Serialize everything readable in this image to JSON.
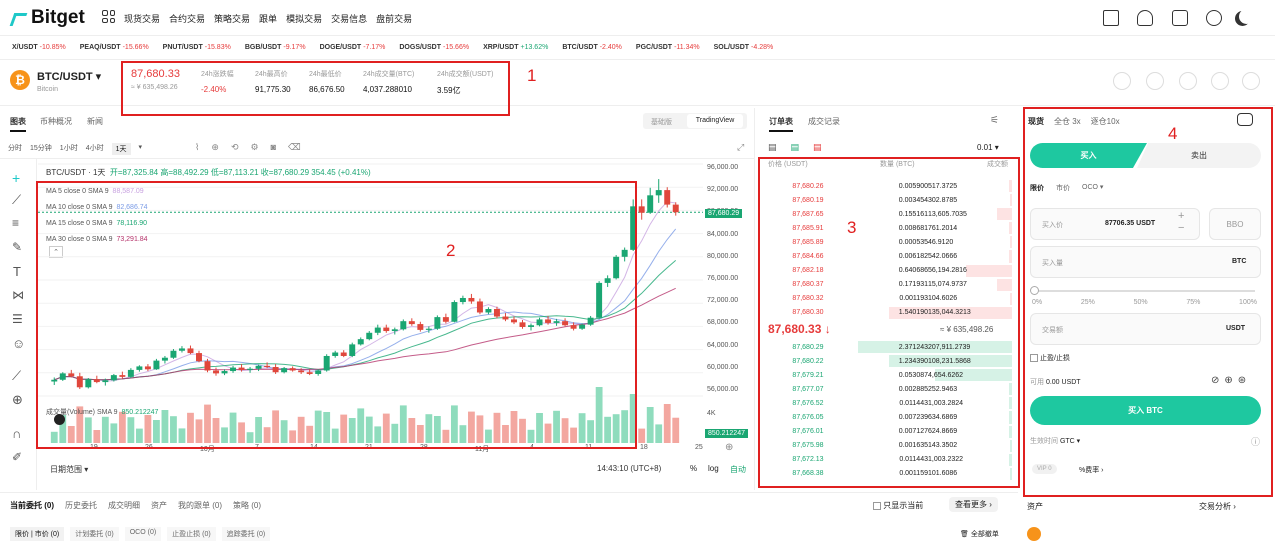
{
  "nav": {
    "brand": "Bitget",
    "items": [
      "现货交易",
      "合约交易",
      "策略交易",
      "跟单",
      "模拟交易",
      "交易信息",
      "盘前交易"
    ]
  },
  "ticker": [
    {
      "sym": "X/USDT",
      "chg": "-10.85%",
      "up": false
    },
    {
      "sym": "PEAQ/USDT",
      "chg": "-15.66%",
      "up": false
    },
    {
      "sym": "PNUT/USDT",
      "chg": "-15.83%",
      "up": false
    },
    {
      "sym": "BGB/USDT",
      "chg": "-9.17%",
      "up": false
    },
    {
      "sym": "DOGE/USDT",
      "chg": "-7.17%",
      "up": false
    },
    {
      "sym": "DOGS/USDT",
      "chg": "-15.66%",
      "up": false
    },
    {
      "sym": "XRP/USDT",
      "chg": "+13.62%",
      "up": true
    },
    {
      "sym": "BTC/USDT",
      "chg": "-2.40%",
      "up": false
    },
    {
      "sym": "PGC/USDT",
      "chg": "-11.34%",
      "up": false
    },
    {
      "sym": "SOL/USDT",
      "chg": "-4.28%",
      "up": false
    }
  ],
  "pair": {
    "name": "BTC/USDT",
    "sub": "Bitcoin",
    "price": "87,680.33",
    "cny": "≈ ¥ 635,498.26",
    "stats": [
      {
        "label": "24h涨跌幅",
        "value": "-2.40%",
        "red": true
      },
      {
        "label": "24h最高价",
        "value": "91,775.30"
      },
      {
        "label": "24h最低价",
        "value": "86,676.50"
      },
      {
        "label": "24h成交量(BTC)",
        "value": "4,037.288010"
      },
      {
        "label": "24h成交额(USDT)",
        "value": "3.59亿"
      }
    ]
  },
  "annotations": [
    "1",
    "2",
    "3",
    "4"
  ],
  "chart": {
    "tabs": [
      "图表",
      "币种概况",
      "新闻"
    ],
    "views": [
      "基础版",
      "TradingView"
    ],
    "intervals": [
      "分时",
      "15分钟",
      "1小时",
      "4小时",
      "1天"
    ],
    "title": "BTC/USDT · 1天",
    "ohlc": {
      "open": "开=87,325.84",
      "high": "高=88,492.29",
      "low": "低=87,113.21",
      "close": "收=87,680.29",
      "change": "354.45 (+0.41%)"
    },
    "ma": [
      {
        "label": "MA 5 close 0 SMA 9",
        "value": "88,587.09",
        "color": "#c8a2e0"
      },
      {
        "label": "MA 10 close 0 SMA 9",
        "value": "82,686.74",
        "color": "#7a9be6"
      },
      {
        "label": "MA 15 close 0 SMA 9",
        "value": "78,116.90",
        "color": "#1aa672"
      },
      {
        "label": "MA 30 close 0 SMA 9",
        "value": "73,291.84",
        "color": "#b5336b"
      }
    ],
    "volume_label": "成交量(Volume) SMA 9",
    "volume_value": "850.212247",
    "yticks": [
      "96,000.00",
      "92,000.00",
      "88,000.00",
      "84,000.00",
      "80,000.00",
      "76,000.00",
      "72,000.00",
      "68,000.00",
      "64,000.00",
      "60,000.00",
      "56,000.00"
    ],
    "price_tag": "87,680.29",
    "vol_tag": "850.212247",
    "vol_axis": "4K",
    "date_range": "日期范围",
    "time": "14:43:10 (UTC+8)",
    "pct": "%",
    "log": "log",
    "auto": "自动",
    "xlabels": [
      "19",
      "26",
      "10月",
      "7",
      "14",
      "21",
      "28",
      "11月",
      "4",
      "11",
      "18",
      "25"
    ]
  },
  "chart_data": {
    "type": "candlestick",
    "ylim": [
      56000,
      96000
    ],
    "candles": [
      [
        58500,
        59200,
        57900,
        58800
      ],
      [
        58800,
        60100,
        58600,
        59900
      ],
      [
        59900,
        60500,
        59200,
        59400
      ],
      [
        59400,
        60000,
        57200,
        57500
      ],
      [
        57500,
        59100,
        57300,
        58900
      ],
      [
        58900,
        59500,
        58200,
        58400
      ],
      [
        58400,
        59000,
        57800,
        58700
      ],
      [
        58700,
        59800,
        58500,
        59600
      ],
      [
        59600,
        60200,
        59000,
        59300
      ],
      [
        59300,
        60800,
        59100,
        60500
      ],
      [
        60500,
        61300,
        60200,
        61100
      ],
      [
        61100,
        61500,
        60300,
        60600
      ],
      [
        60600,
        62400,
        60500,
        62100
      ],
      [
        62100,
        62900,
        61600,
        62600
      ],
      [
        62600,
        64100,
        62400,
        63800
      ],
      [
        63800,
        64600,
        63500,
        64200
      ],
      [
        64200,
        64700,
        63200,
        63400
      ],
      [
        63400,
        63800,
        61800,
        62000
      ],
      [
        62000,
        62400,
        60100,
        60400
      ],
      [
        60400,
        60900,
        59500,
        59900
      ],
      [
        59900,
        60600,
        59600,
        60300
      ],
      [
        60300,
        61200,
        60000,
        60900
      ],
      [
        60900,
        61500,
        60200,
        60500
      ],
      [
        60500,
        61000,
        60000,
        60700
      ],
      [
        60700,
        61400,
        60300,
        61200
      ],
      [
        61200,
        61800,
        60800,
        61000
      ],
      [
        61000,
        61500,
        59800,
        60100
      ],
      [
        60100,
        61000,
        59900,
        60800
      ],
      [
        60800,
        61100,
        60200,
        60400
      ],
      [
        60400,
        60800,
        59800,
        60100
      ],
      [
        60100,
        60600,
        59600,
        59800
      ],
      [
        59800,
        60600,
        59500,
        60400
      ],
      [
        60400,
        63200,
        60200,
        62900
      ],
      [
        62900,
        63800,
        62600,
        63500
      ],
      [
        63500,
        63900,
        62700,
        62900
      ],
      [
        62900,
        65200,
        62700,
        64900
      ],
      [
        64900,
        66100,
        64700,
        65800
      ],
      [
        65800,
        67200,
        65600,
        66900
      ],
      [
        66900,
        68300,
        66500,
        67800
      ],
      [
        67800,
        68300,
        66900,
        67200
      ],
      [
        67200,
        67800,
        66600,
        67500
      ],
      [
        67500,
        69200,
        67300,
        68900
      ],
      [
        68900,
        69400,
        68100,
        68400
      ],
      [
        68400,
        68800,
        67100,
        67400
      ],
      [
        67400,
        68000,
        66900,
        67600
      ],
      [
        67600,
        69900,
        67400,
        69600
      ],
      [
        69600,
        70200,
        68500,
        68800
      ],
      [
        68800,
        72500,
        68700,
        72200
      ],
      [
        72200,
        73300,
        71800,
        72900
      ],
      [
        72900,
        73600,
        71900,
        72300
      ],
      [
        72300,
        72800,
        70100,
        70400
      ],
      [
        70400,
        71300,
        70100,
        71000
      ],
      [
        71000,
        71400,
        69400,
        69700
      ],
      [
        69700,
        70300,
        68900,
        69200
      ],
      [
        69200,
        69700,
        68400,
        68700
      ],
      [
        68700,
        69100,
        67600,
        67900
      ],
      [
        67900,
        68500,
        67300,
        68200
      ],
      [
        68200,
        69500,
        68000,
        69200
      ],
      [
        69200,
        69800,
        68300,
        68600
      ],
      [
        68600,
        69300,
        68100,
        68900
      ],
      [
        68900,
        69400,
        68000,
        68200
      ],
      [
        68200,
        68700,
        67300,
        67600
      ],
      [
        67600,
        68500,
        67400,
        68300
      ],
      [
        68300,
        69800,
        68100,
        69500
      ],
      [
        69500,
        75800,
        69300,
        75500
      ],
      [
        75500,
        76800,
        74800,
        76300
      ],
      [
        76300,
        80300,
        76100,
        80000
      ],
      [
        80000,
        81600,
        79200,
        81200
      ],
      [
        81200,
        89900,
        81000,
        88700
      ],
      [
        88700,
        89900,
        86400,
        87600
      ],
      [
        87600,
        91900,
        87400,
        90600
      ],
      [
        90600,
        93400,
        89300,
        91500
      ],
      [
        91500,
        92000,
        88500,
        89000
      ],
      [
        89000,
        89400,
        87100,
        87680
      ]
    ],
    "volume_series": "relative",
    "title": "BTC/USDT · 1天"
  },
  "orderbook": {
    "tabs": [
      "订单表",
      "成交记录"
    ],
    "precision": "0.01",
    "headers": [
      "价格 (USDT)",
      "数量 (BTC)",
      "成交额"
    ],
    "asks": [
      [
        "87,680.26",
        "0.005900",
        "517.3725",
        0.02
      ],
      [
        "87,680.19",
        "0.003454",
        "302.8785",
        0.01
      ],
      [
        "87,687.65",
        "0.155161",
        "13,605.7035",
        0.1
      ],
      [
        "87,685.91",
        "0.008681",
        "761.2014",
        0.02
      ],
      [
        "87,685.89",
        "0.000535",
        "46.9120",
        0.01
      ],
      [
        "87,684.66",
        "0.006182",
        "542.0666",
        0.02
      ],
      [
        "87,682.18",
        "0.640686",
        "56,194.2816",
        0.3
      ],
      [
        "87,680.37",
        "0.171931",
        "15,074.9737",
        0.1
      ],
      [
        "87,680.32",
        "0.001193",
        "104.6026",
        0.01
      ],
      [
        "87,680.30",
        "1.540190",
        "135,044.3213",
        0.8
      ]
    ],
    "mid": "87,680.33",
    "mid_arrow": "↓",
    "mid_cny": "≈ ¥ 635,498.26",
    "bids": [
      [
        "87,680.29",
        "2.371243",
        "207,911.2739",
        1.0
      ],
      [
        "87,680.22",
        "1.234390",
        "108,231.5868",
        0.8
      ],
      [
        "87,679.21",
        "0.053087",
        "4,654.6262",
        0.5
      ],
      [
        "87,677.07",
        "0.002885",
        "252.9463",
        0.02
      ],
      [
        "87,676.52",
        "0.011443",
        "1,003.2824",
        0.02
      ],
      [
        "87,676.05",
        "0.007239",
        "634.6869",
        0.02
      ],
      [
        "87,676.01",
        "0.007127",
        "624.8669",
        0.02
      ],
      [
        "87,675.98",
        "0.001635",
        "143.3502",
        0.01
      ],
      [
        "87,672.13",
        "0.011443",
        "1,003.2322",
        0.02
      ],
      [
        "87,668.38",
        "0.001159",
        "101.6086",
        0.01
      ]
    ]
  },
  "trade": {
    "tabs": [
      "现货",
      "全仓 3x",
      "逐仓10x"
    ],
    "buy": "买入",
    "sell": "卖出",
    "types": [
      "限价",
      "市价",
      "OCO"
    ],
    "price_label": "买入价",
    "price_value": "87706.35 USDT",
    "bbo": "BBO",
    "qty_label": "买入量",
    "qty_unit": "BTC",
    "pcts": [
      "0%",
      "25%",
      "50%",
      "75%",
      "100%"
    ],
    "amount_label": "交易额",
    "amount_unit": "USDT",
    "tpsl": "止盈/止损",
    "avail_label": "可用",
    "avail_value": "0.00 USDT",
    "submit": "买入 BTC",
    "tif_label": "生效时间",
    "tif_value": "GTC",
    "vip": "VIP 0",
    "fee": "%费率",
    "assets": "资产",
    "analysis": "交易分析"
  },
  "bottom": {
    "tabs": [
      "当前委托 (0)",
      "历史委托",
      "成交明细",
      "资产",
      "我的跟单 (0)",
      "策略 (0)"
    ],
    "subtabs": [
      "限价 | 市价 (0)",
      "计划委托 (0)",
      "OCO (0)",
      "止盈止损 (0)",
      "追踪委托 (0)"
    ],
    "only_current": "只显示当前",
    "more": "查看更多",
    "cancel_all": "全部撤单"
  }
}
